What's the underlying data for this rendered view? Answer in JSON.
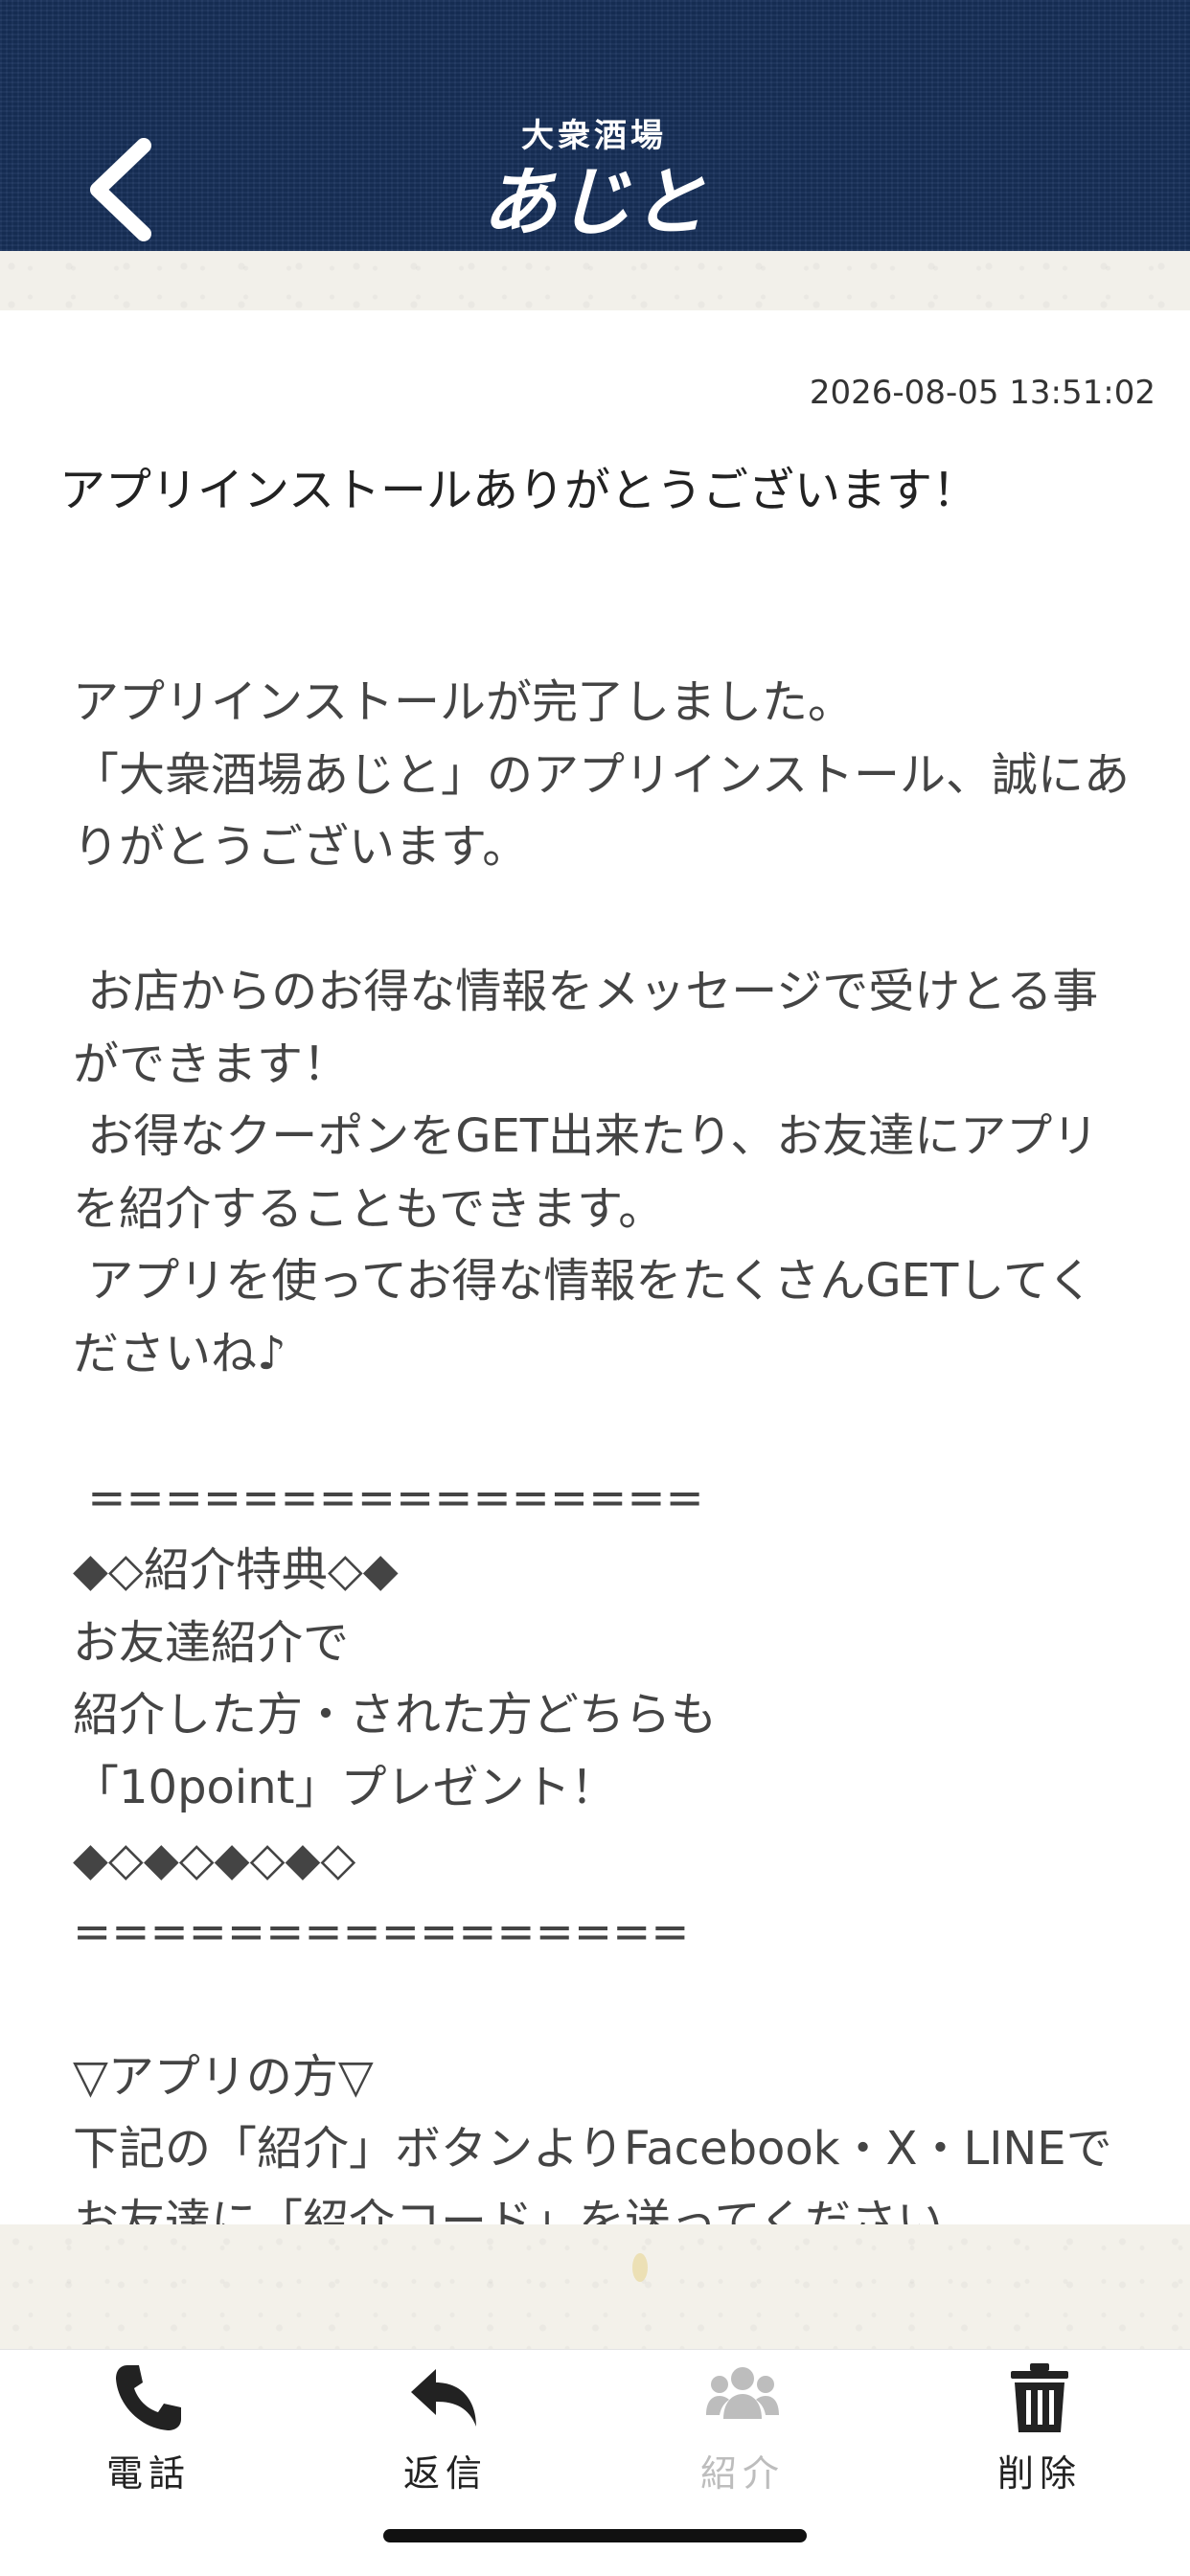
{
  "header": {
    "logo_small": "大衆酒場",
    "logo_big": "あじと",
    "header_color": "#17305a"
  },
  "message": {
    "timestamp": "2026-08-05 13:51:02",
    "title": "アプリインストールありがとうございます！",
    "body": "アプリインストールが完了しました。\n「大衆酒場あじと」のアプリインストール、誠にありがとうございます。\n\n お店からのお得な情報をメッセージで受けとる事ができます！\n お得なクーポンをGET出来たり、お友達にアプリを紹介することもできます。\n アプリを使ってお得な情報をたくさんGETしてくださいね♪\n\n ================\n◆◇紹介特典◇◆\nお友達紹介で\n紹介した方・された方どちらも\n「10point」プレゼント！\n◆◇◆◇◆◇◆◇\n================\n\n▽アプリの方▽\n下記の「紹介」ボタンよりFacebook・X・LINEでお友達に「紹介コード」を送ってください。"
  },
  "tabbar": {
    "items": [
      {
        "label": "電話",
        "icon": "phone-icon",
        "enabled": true
      },
      {
        "label": "返信",
        "icon": "reply-icon",
        "enabled": true
      },
      {
        "label": "紹介",
        "icon": "users-icon",
        "enabled": false
      },
      {
        "label": "削除",
        "icon": "trash-icon",
        "enabled": true
      }
    ],
    "active_color": "#222222",
    "disabled_color": "#bdbdbd"
  }
}
